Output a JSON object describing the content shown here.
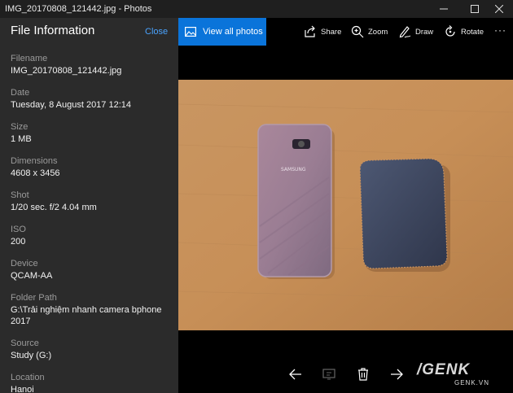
{
  "window": {
    "title": "IMG_20170808_121442.jpg - Photos"
  },
  "panel": {
    "title": "File Information",
    "close_label": "Close",
    "fields": [
      {
        "label": "Filename",
        "value": "IMG_20170808_121442.jpg"
      },
      {
        "label": "Date",
        "value": "Tuesday, 8 August 2017 12:14"
      },
      {
        "label": "Size",
        "value": "1 MB"
      },
      {
        "label": "Dimensions",
        "value": "4608 x 3456"
      },
      {
        "label": "Shot",
        "value": "1/20 sec. f/2 4.04 mm"
      },
      {
        "label": "ISO",
        "value": "200"
      },
      {
        "label": "Device",
        "value": "QCAM-AA"
      },
      {
        "label": "Folder Path",
        "value": "G:\\Trải nghiệm nhanh camera bphone",
        "value2": "2017"
      },
      {
        "label": "Source",
        "value": "Study (G:)"
      },
      {
        "label": "Location",
        "value": "Hanoi"
      }
    ]
  },
  "toolbar": {
    "view_all_label": "View all photos",
    "share_label": "Share",
    "zoom_label": "Zoom",
    "draw_label": "Draw",
    "rotate_label": "Rotate",
    "more_label": "···"
  },
  "photo": {
    "phone_brand": "SAMSUNG"
  },
  "watermark": {
    "main": "/GENK",
    "sub": "GENK.VN"
  },
  "colors": {
    "accent": "#0a74da",
    "sidebar_bg": "#2b2b2b",
    "link": "#4aa3ff",
    "table_wood": "#c8955e"
  },
  "icons": [
    "minimize-icon",
    "maximize-icon",
    "close-icon",
    "photos-icon",
    "share-icon",
    "zoom-icon",
    "draw-icon",
    "rotate-icon",
    "more-icon",
    "arrow-left-icon",
    "slideshow-icon",
    "delete-icon",
    "arrow-right-icon"
  ]
}
